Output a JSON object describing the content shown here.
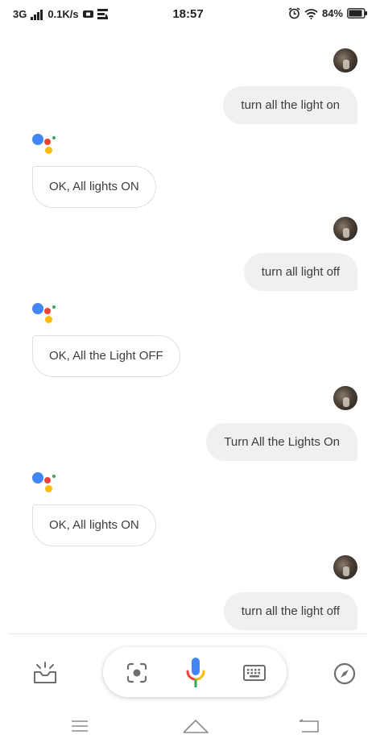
{
  "status_bar": {
    "network": "3G",
    "speed": "0.1K/s",
    "time": "18:57",
    "battery": "84%"
  },
  "conversation": [
    {
      "role": "user",
      "text": "turn all the light on"
    },
    {
      "role": "assistant",
      "text": "OK, All lights ON"
    },
    {
      "role": "user",
      "text": "turn all light off"
    },
    {
      "role": "assistant",
      "text": "OK, All the Light OFF"
    },
    {
      "role": "user",
      "text": "Turn All the Lights On"
    },
    {
      "role": "assistant",
      "text": "OK, All lights ON"
    },
    {
      "role": "user",
      "text": "turn all the light off"
    }
  ],
  "colors": {
    "google_blue": "#4285F4",
    "google_red": "#EA4335",
    "google_yellow": "#FBBC05",
    "google_green": "#34A853",
    "user_bubble": "#eef0f2",
    "icon_gray": "#6e6e6e"
  },
  "icons": {
    "updates": "tray-sparkle-icon",
    "lens": "lens-camera-icon",
    "mic": "microphone-icon",
    "keyboard": "keyboard-icon",
    "explore": "compass-icon",
    "nav_menu": "menu-icon",
    "nav_home": "home-icon",
    "nav_back": "back-icon"
  }
}
